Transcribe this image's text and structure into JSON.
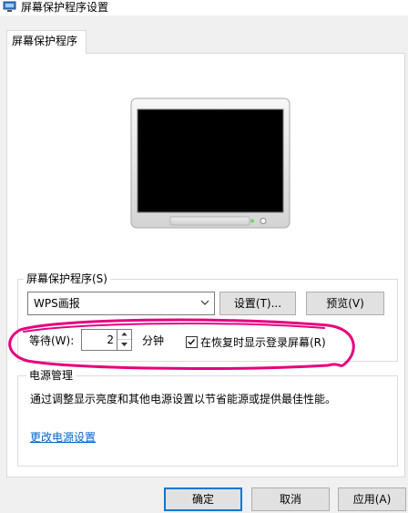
{
  "window": {
    "title": "屏幕保护程序设置",
    "icon": "screensaver-app-icon"
  },
  "tabs": [
    {
      "label": "屏幕保护程序"
    }
  ],
  "preview": {
    "icon": "monitor-preview"
  },
  "screensaver_group": {
    "label": "屏幕保护程序(S)",
    "selected": "WPS画报",
    "settings_label": "设置(T)...",
    "preview_label": "预览(V)",
    "wait_label": "等待(W):",
    "wait_value": "2",
    "wait_unit": "分钟",
    "resume_label": "在恢复时显示登录屏幕(R)",
    "resume_checked": true
  },
  "power_group": {
    "label": "电源管理",
    "description": "通过调整显示亮度和其他电源设置以节省能源或提供最佳性能。",
    "link": "更改电源设置"
  },
  "footer": {
    "ok_label": "确定",
    "cancel_label": "取消",
    "apply_label": "应用(A)"
  },
  "colors": {
    "accent": "#0078d7",
    "link": "#0066cc",
    "annotation": "#e6007e"
  }
}
